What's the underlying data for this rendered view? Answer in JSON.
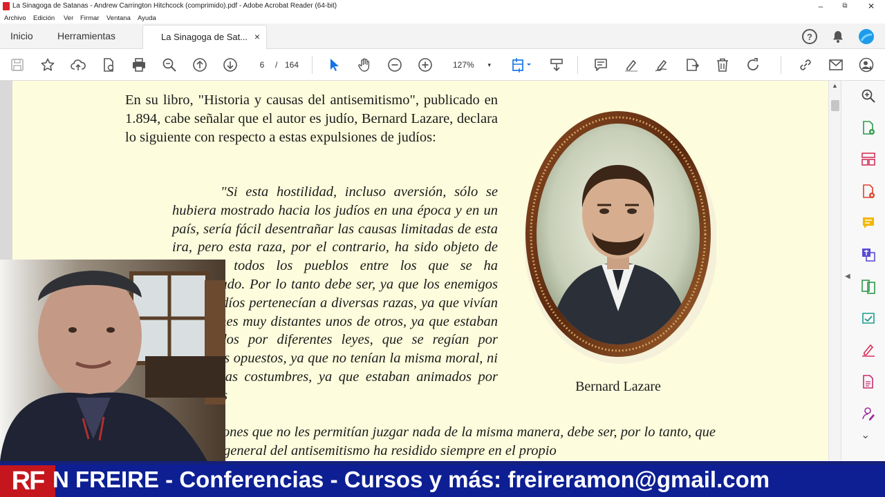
{
  "window": {
    "title": "La Sinagoga de Satanas - Andrew Carrington Hitchcock (comprimido).pdf - Adobe Acrobat Reader (64-bit)",
    "minimize": "–",
    "restore": "⧉",
    "close": "✕"
  },
  "menu": [
    "Archivo",
    "Edición",
    "Ver",
    "Firmar",
    "Ventana",
    "Ayuda"
  ],
  "tabs": {
    "home": "Inicio",
    "tools": "Herramientas",
    "document": "La Sinagoga de Sat...",
    "close": "×"
  },
  "toolbar": {
    "current_page": "6",
    "page_separator": "/",
    "total_pages": "164",
    "zoom": "127%",
    "zoom_caret": "▾"
  },
  "document": {
    "paragraph": "En su libro, \"Historia y causas del antisemitismo\", publicado en 1.894, cabe señalar que el autor es judío, Bernard Lazare, declara lo siguiente con respecto a estas expulsiones de judíos:",
    "quote": "\"Si esta hostilidad, incluso aversión, sólo se hubiera mostrado hacia los judíos en una época y en un país, sería fácil desentrañar las causas limitadas de esta ira, pero esta raza, por el contrario, ha sido objeto de odio en todos los pueblos entre los que se ha consolidado. Por lo tanto debe ser, ya que los enemigos de los judíos pertenecían a diversas razas, ya que vivían en regiones muy distantes unos de otros, ya que estaban gobernados por diferentes leyes, que se regían por principios opuestos, ya que no tenían la misma moral, ni las mismas costumbres, ya que estaban animados por diferentes",
    "quote_continued": "disposiciones que no les permitían juzgar nada de la misma manera, debe ser, por lo tanto, que la causa general del antisemitismo ha residido siempre en el propio",
    "caption": "Bernard Lazare"
  },
  "scroll": {
    "up": "▲"
  },
  "side_panel": {
    "collapse": "◀",
    "more": "⌄"
  },
  "banner": {
    "logo": "RF",
    "ticker": "N FREIRE - Conferencias - Cursos y más:  freireramon@gmail.com"
  },
  "colors": {
    "page_background": "#fdfddd",
    "banner_background": "#0d1f93",
    "logo_red": "#c4161c",
    "acrobat_blue": "#1473e6"
  }
}
